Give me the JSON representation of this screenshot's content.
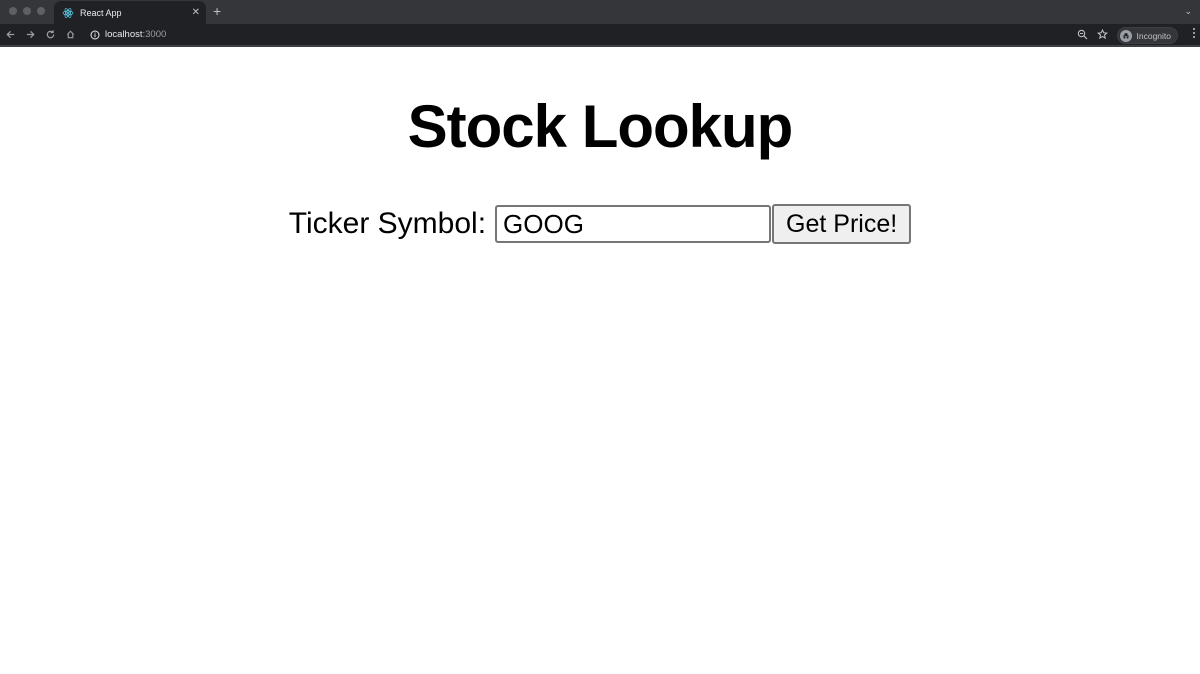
{
  "browser": {
    "tab_title": "React App",
    "url_host": "localhost",
    "url_port": ":3000",
    "profile_label": "Incognito"
  },
  "app": {
    "heading": "Stock Lookup",
    "ticker_label": "Ticker Symbol:",
    "ticker_value": "GOOG",
    "submit_label": "Get Price!"
  },
  "icons": {
    "favicon": "react-icon",
    "tab_close": "close-icon",
    "new_tab": "plus-icon",
    "back": "arrow-left-icon",
    "forward": "arrow-right-icon",
    "reload": "reload-icon",
    "home": "home-icon",
    "site_info": "info-icon",
    "zoom": "zoom-icon",
    "bookmark": "star-icon",
    "incognito": "incognito-icon",
    "menu": "kebab-menu-icon"
  },
  "colors": {
    "chrome_dark": "#202124",
    "tabstrip": "#35363a",
    "page_bg": "#ffffff"
  }
}
